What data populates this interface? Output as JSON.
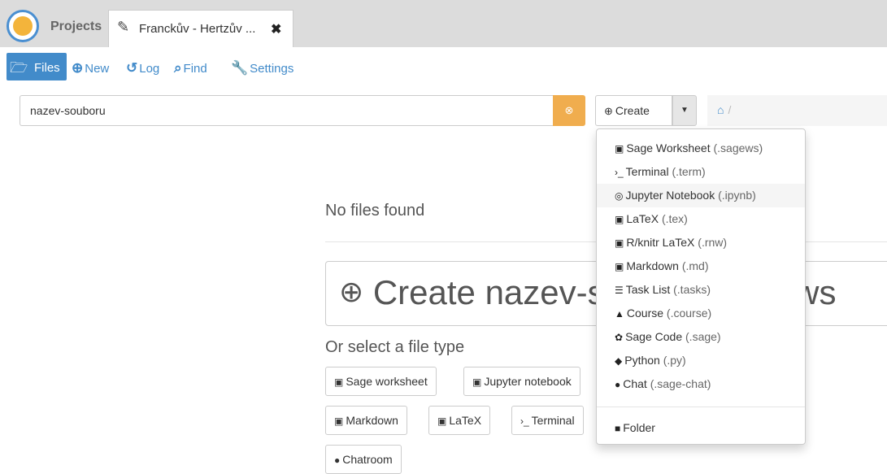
{
  "topbar": {
    "projects_label": "Projects",
    "file_tab_title": "Franckův - Hertzův ...",
    "close_glyph": "✖"
  },
  "nav": {
    "files": "Files",
    "new": "New",
    "log": "Log",
    "find": "Find",
    "settings": "Settings"
  },
  "search": {
    "value": "nazev-souboru"
  },
  "create_button": {
    "label": "Create"
  },
  "main": {
    "no_files": "No files found",
    "big_create": "Create nazev-souboru.sagews",
    "or_select": "Or select a file type",
    "file_types": [
      "Sage worksheet",
      "Jupyter notebook",
      "Markdown",
      "LaTeX",
      "Terminal",
      "Chatroom"
    ]
  },
  "dropdown": {
    "items": [
      {
        "label": "Sage Worksheet",
        "ext": "(.sagews)",
        "icon": "sage-worksheet-icon"
      },
      {
        "label": "Terminal",
        "ext": "(.term)",
        "icon": "terminal-icon"
      },
      {
        "label": "Jupyter Notebook",
        "ext": "(.ipynb)",
        "icon": "jupyter-icon"
      },
      {
        "label": "LaTeX",
        "ext": "(.tex)",
        "icon": "tex-file-icon"
      },
      {
        "label": "R/knitr LaTeX",
        "ext": "(.rnw)",
        "icon": "tex-file-icon"
      },
      {
        "label": "Markdown",
        "ext": "(.md)",
        "icon": "markdown-icon"
      },
      {
        "label": "Task List",
        "ext": "(.tasks)",
        "icon": "tasks-icon"
      },
      {
        "label": "Course",
        "ext": "(.course)",
        "icon": "graduation-cap-icon"
      },
      {
        "label": "Sage Code",
        "ext": "(.sage)",
        "icon": "sage-code-icon"
      },
      {
        "label": "Python",
        "ext": "(.py)",
        "icon": "python-icon"
      },
      {
        "label": "Chat",
        "ext": "(.sage-chat)",
        "icon": "chat-bubble-icon"
      }
    ],
    "folder": "Folder"
  },
  "colors": {
    "accent": "#428bca",
    "warning": "#f0ad4e",
    "topbar": "#dcdcdc"
  }
}
